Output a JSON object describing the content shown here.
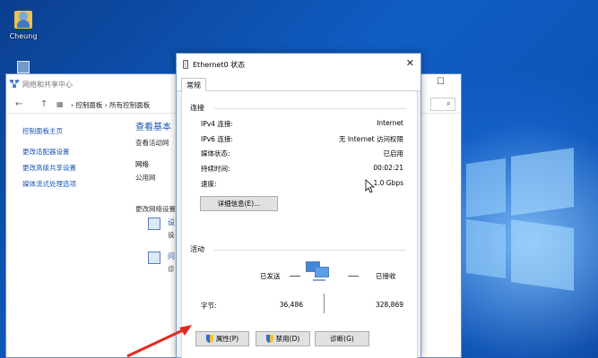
{
  "desktop": {
    "user_icon_label": "Cheung"
  },
  "background_window": {
    "title": "网络和共享中心",
    "breadcrumb": [
      "控制面板",
      "所有控制面板"
    ],
    "left_links": [
      "控制面板主页",
      "更改适配器设置",
      "更改高级共享设置",
      "媒体流式处理选项"
    ],
    "heading": "查看基本",
    "subheading": "查看活动网",
    "network_label": "网络",
    "network_type": "公用网",
    "change_settings": "更改网络设置",
    "task1_title": "设",
    "task1_desc": "设",
    "task2_title": "问",
    "task2_desc": "诊"
  },
  "dialog": {
    "title": "Ethernet0 状态",
    "tab": "常规",
    "connection_label": "连接",
    "rows": [
      {
        "key": "IPv4 连接:",
        "value": "Internet"
      },
      {
        "key": "IPv6 连接:",
        "value": "无 Internet 访问权限"
      },
      {
        "key": "媒体状态:",
        "value": "已启用"
      },
      {
        "key": "持续时间:",
        "value": "00:02:21"
      },
      {
        "key": "速度:",
        "value": "1.0 Gbps"
      }
    ],
    "details_button": "详细信息(E)...",
    "activity_label": "活动",
    "sent_label": "已发送",
    "received_label": "已接收",
    "bytes_label": "字节:",
    "bytes_sent": "36,486",
    "bytes_received": "328,869",
    "buttons": {
      "properties": "属性(P)",
      "disable": "禁用(D)",
      "diagnose": "诊断(G)"
    }
  },
  "colors": {
    "link": "#1a55b5",
    "annotation_arrow": "#e02a1e",
    "shield_blue": "#2f6fc8",
    "shield_yellow": "#f2c23a"
  }
}
